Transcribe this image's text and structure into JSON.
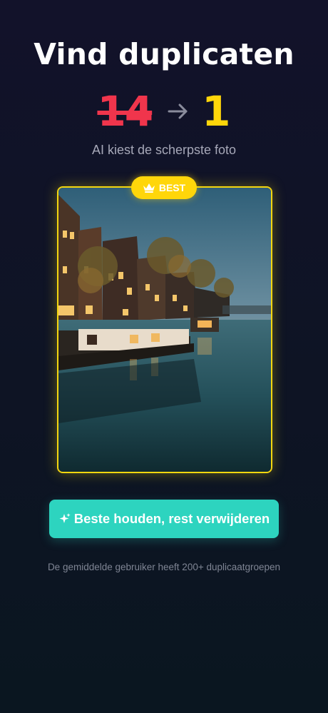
{
  "header": {
    "title": "Vind duplicaten",
    "count_before": "14",
    "count_after": "1",
    "subtitle": "AI kiest de scherpste foto"
  },
  "photo": {
    "badge_label": "BEST",
    "badge_icon": "crown-icon",
    "border_color": "#f4d60f"
  },
  "cta": {
    "label": "Beste houden, rest verwijderen",
    "icon": "sparkle-icon",
    "color": "#2dd4bf"
  },
  "footer": {
    "note": "De gemiddelde gebruiker heeft 200+ duplicaatgroepen"
  },
  "colors": {
    "background": "#12122a",
    "old_count": "#f0354c",
    "new_count": "#ffd60a",
    "arrow": "#8a8c9c"
  }
}
